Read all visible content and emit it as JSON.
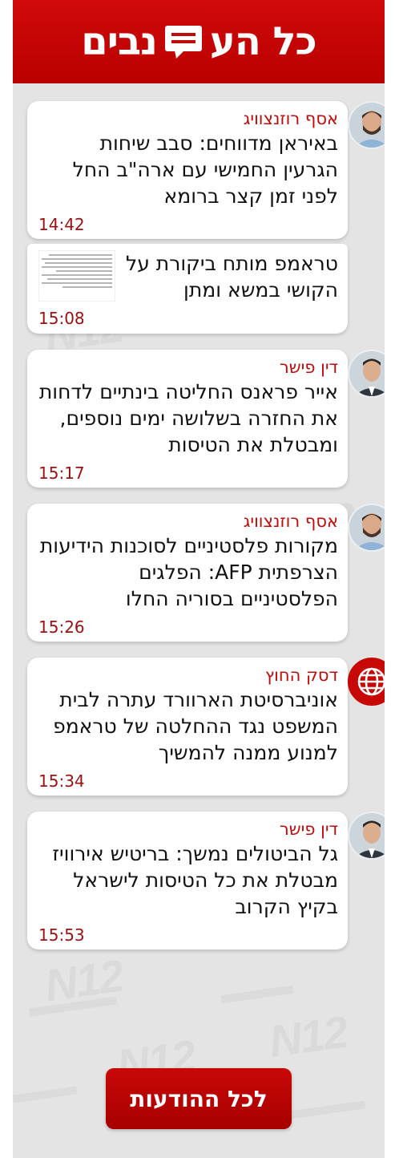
{
  "header": {
    "logo_left": "כל הע",
    "logo_right": "נבים"
  },
  "cards": [
    {
      "author": "אסף רוזנצוויג",
      "headline": "באיראן מדווחים: סבב שיחות הגרעין החמישי עם ארה\"ב החל לפני זמן קצר ברומא",
      "time": "14:42"
    },
    {
      "author": "",
      "headline": "טראמפ מותח ביקורת על הקושי במשא ומתן",
      "time": "15:08"
    },
    {
      "author": "דין פישר",
      "headline": "אייר פראנס החליטה בינתיים לדחות את החזרה בשלושה ימים נוספים, ומבטלת את הטיסות",
      "time": "15:17"
    },
    {
      "author": "אסף רוזנצוויג",
      "headline": "מקורות פלסטיניים לסוכנות הידיעות הצרפתית AFP: הפלגים הפלסטיניים בסוריה החלו",
      "time": "15:26"
    },
    {
      "author": "דסק החוץ",
      "headline": "אוניברסיטת הארוורד עתרה לבית המשפט נגד ההחלטה של טראמפ למנוע ממנה להמשיך",
      "time": "15:34"
    },
    {
      "author": "דין פישר",
      "headline": "גל הביטולים נמשך: בריטיש אירוויז מבטלת את כל הטיסות לישראל בקיץ הקרוב",
      "time": "15:53"
    }
  ],
  "footer": {
    "all_updates_label": "לכל ההודעות"
  },
  "colors": {
    "brand_red": "#c80707",
    "time_red": "#9a0f0f",
    "background": "#e4e4e4"
  },
  "icons": {
    "avatar_globe": "globe-icon",
    "logo": "speech-bubble-icon"
  }
}
